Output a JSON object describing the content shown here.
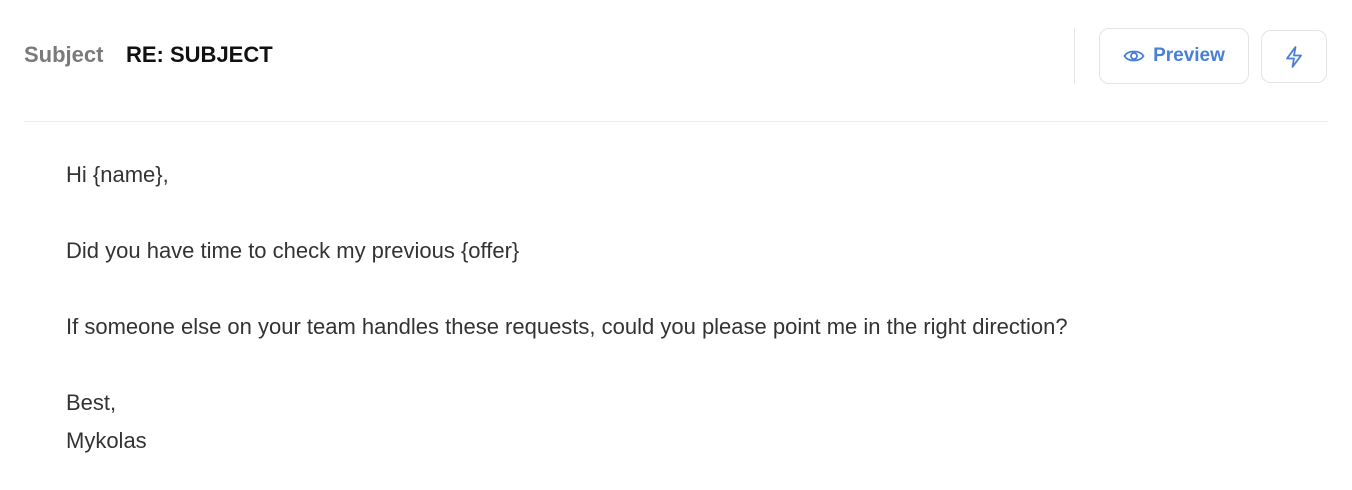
{
  "subject": {
    "label": "Subject",
    "value": "RE: SUBJECT"
  },
  "toolbar": {
    "preview_label": "Preview",
    "preview_icon": "eye-icon",
    "bolt_icon": "lightning-icon",
    "accent_color": "#4a7fd6"
  },
  "email_body": {
    "greeting": "Hi {name},",
    "line1": "Did you have time to check my previous {offer}",
    "line2": "If someone else on your team handles these requests, could you please point me in the right direction?",
    "signoff": "Best,",
    "signature": "Mykolas"
  }
}
